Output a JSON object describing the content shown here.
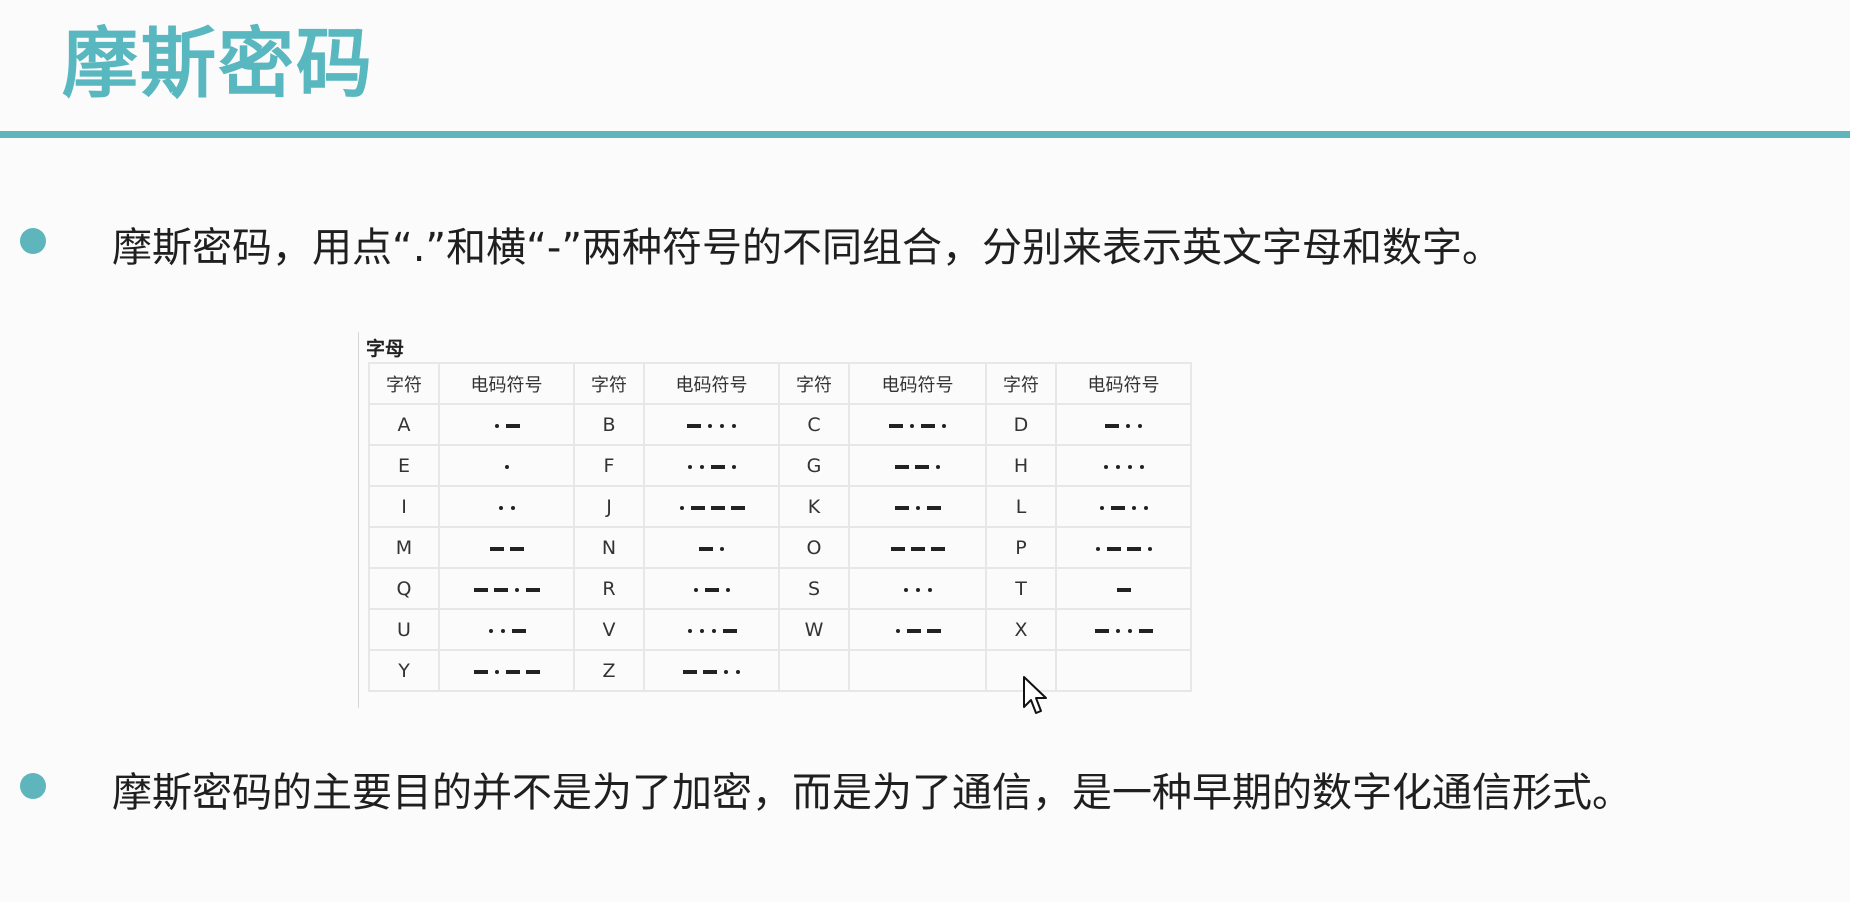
{
  "slide": {
    "title": "摩斯密码",
    "bullets": [
      "摩斯密码，用点“.”和横“-”两种符号的不同组合，分别来表示英文字母和数字。",
      "摩斯密码的主要目的并不是为了加密，而是为了通信，是一种早期的数字化通信形式。"
    ]
  },
  "table": {
    "caption": "字母",
    "headers": [
      "字符",
      "电码符号",
      "字符",
      "电码符号",
      "字符",
      "电码符号",
      "字符",
      "电码符号"
    ],
    "rows": [
      [
        [
          "A",
          ".-"
        ],
        [
          "B",
          "-..."
        ],
        [
          "C",
          "-.-."
        ],
        [
          "D",
          "-.."
        ]
      ],
      [
        [
          "E",
          "."
        ],
        [
          "F",
          "..-."
        ],
        [
          "G",
          "--."
        ],
        [
          "H",
          "...."
        ]
      ],
      [
        [
          "I",
          ".."
        ],
        [
          "J",
          ".---"
        ],
        [
          "K",
          "-.-"
        ],
        [
          "L",
          ".-.."
        ]
      ],
      [
        [
          "M",
          "--"
        ],
        [
          "N",
          "-."
        ],
        [
          "O",
          "---"
        ],
        [
          "P",
          ".--."
        ]
      ],
      [
        [
          "Q",
          "--.-"
        ],
        [
          "R",
          ".-."
        ],
        [
          "S",
          "..."
        ],
        [
          "T",
          "-"
        ]
      ],
      [
        [
          "U",
          "..-"
        ],
        [
          "V",
          "...-"
        ],
        [
          "W",
          ".--"
        ],
        [
          "X",
          "-..-"
        ]
      ],
      [
        [
          "Y",
          "-.--"
        ],
        [
          "Z",
          "--.."
        ],
        [
          "",
          ""
        ],
        [
          "",
          ""
        ]
      ]
    ]
  },
  "colors": {
    "accent": "#5fb5bc",
    "title": "#58b7bf"
  },
  "icons": {
    "cursor": "mouse-pointer-icon"
  }
}
